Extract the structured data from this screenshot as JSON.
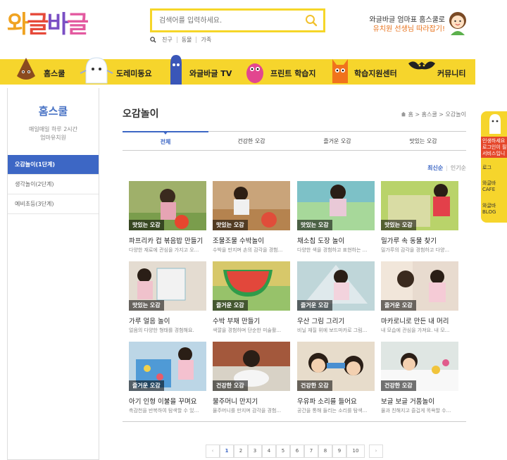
{
  "header": {
    "logo_text": "와글바글",
    "search": {
      "placeholder": "검색어를 입력하세요."
    },
    "hot_keywords": [
      "친구",
      "동물",
      "가족"
    ],
    "promo_line1": "와글바글 엄마표 홈스쿨로",
    "promo_line2": "유치원 선생님 따라잡기!"
  },
  "nav": {
    "items": [
      {
        "label": "홈스쿨"
      },
      {
        "label": "도레미동요"
      },
      {
        "label": "와글바글 TV"
      },
      {
        "label": "프린트 학습지"
      },
      {
        "label": "학습지원센터"
      },
      {
        "label": "커뮤니티"
      }
    ]
  },
  "sidebar": {
    "title": "홈스쿨",
    "subtitle1": "매일매일 하루 2시간",
    "subtitle2": "엄마유치원",
    "items": [
      {
        "label": "오감놀이(1단계)",
        "active": true
      },
      {
        "label": "생각놀이(2단계)",
        "active": false
      },
      {
        "label": "예비초등(3단계)",
        "active": false
      }
    ]
  },
  "main": {
    "title": "오감놀이",
    "breadcrumb": [
      "홈",
      "홈스쿨",
      "오감놀이"
    ],
    "tabs": [
      "전체",
      "건강한 오감",
      "즐거운 오감",
      "맛있는 오감"
    ],
    "sort": {
      "latest": "최신순",
      "popular": "인기순"
    },
    "cards": [
      {
        "badge": "맛있는 오감",
        "title": "파프리카 컵 볶음밥 만들기",
        "desc": "다양한 재료에 관심을 가지고 오..."
      },
      {
        "badge": "맛있는 오감",
        "title": "조물조물 수박놀이",
        "desc": "수박을 만지며 손의 감각을 경험..."
      },
      {
        "badge": "맛있는 오감",
        "title": "채소칩 도장 놀이",
        "desc": "다양한 색을 경험하고 표현하는 ..."
      },
      {
        "badge": "맛있는 오감",
        "title": "밀가루 속 동물 찾기",
        "desc": "밀가루의 감각을 경험하고 다양..."
      },
      {
        "badge": "맛있는 오감",
        "title": "가루 얼음 놀이",
        "desc": "얼음의 다양한 형태를 경험해요."
      },
      {
        "badge": "즐거운 오감",
        "title": "수박 부채 만들기",
        "desc": "색깔을 경험하며 단순한 미술활..."
      },
      {
        "badge": "즐거운 오감",
        "title": "우산 그림 그리기",
        "desc": "비닐 재질 위에 보드마카로 그림..."
      },
      {
        "badge": "즐거운 오감",
        "title": "마카로니로 만든 내 머리",
        "desc": "내 모습에 관심을 가져요. 내 모..."
      },
      {
        "badge": "즐거운 오감",
        "title": "아기 인형 이불을 꾸며요",
        "desc": "촉감천을 반복하여 탐색할 수 있..."
      },
      {
        "badge": "건강한 오감",
        "title": "물주머니 만지기",
        "desc": "물주머니를 만지며 감각을 경험..."
      },
      {
        "badge": "건강한 오감",
        "title": "우유파 소리를 들어요",
        "desc": "공간을 통해 들리는 소리를 탐색..."
      },
      {
        "badge": "건강한 오감",
        "title": "보글 보글 거품놀이",
        "desc": "물과 친해지고 즐겁게 목욕할 수..."
      }
    ],
    "pages": [
      "1",
      "2",
      "3",
      "4",
      "5",
      "6",
      "7",
      "8",
      "9",
      "10"
    ]
  },
  "float_panel": {
    "notice": "인생하세요 로그인이 필 서비스입니",
    "items": [
      "로그",
      "와글바 CAFE",
      "와글바 BLOG"
    ]
  },
  "colors": {
    "brand_yellow": "#f6d52c",
    "accent_blue": "#3d67c5",
    "accent_orange": "#e8721c"
  }
}
